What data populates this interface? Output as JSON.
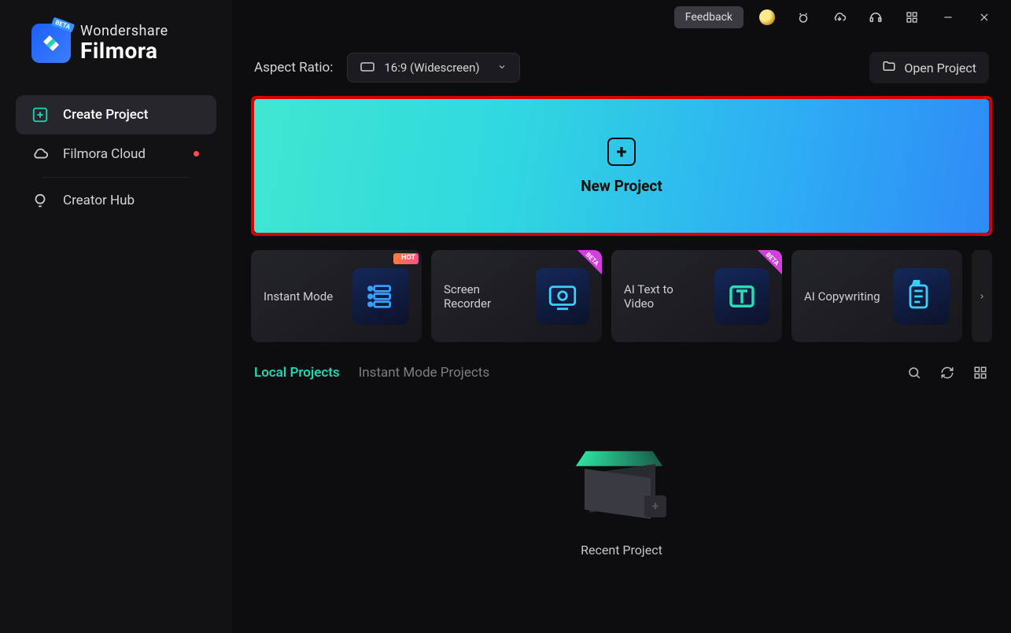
{
  "brand": {
    "sub": "Wondershare",
    "main": "Filmora",
    "badge": "BETA"
  },
  "sidebar": {
    "items": [
      {
        "label": "Create Project"
      },
      {
        "label": "Filmora Cloud"
      },
      {
        "label": "Creator Hub"
      }
    ]
  },
  "titlebar": {
    "feedback": "Feedback"
  },
  "toolbar": {
    "aspect_label": "Aspect Ratio:",
    "aspect_value": "16:9 (Widescreen)",
    "open_project": "Open Project"
  },
  "banner": {
    "label": "New Project"
  },
  "cards": [
    {
      "label": "Instant Mode",
      "badge": "hot"
    },
    {
      "label": "Screen Recorder",
      "badge": "beta"
    },
    {
      "label": "AI Text to Video",
      "badge": "beta"
    },
    {
      "label": "AI Copywriting",
      "badge": ""
    }
  ],
  "tabs": {
    "items": [
      {
        "label": "Local Projects"
      },
      {
        "label": "Instant Mode Projects"
      }
    ]
  },
  "empty": {
    "label": "Recent Project"
  }
}
